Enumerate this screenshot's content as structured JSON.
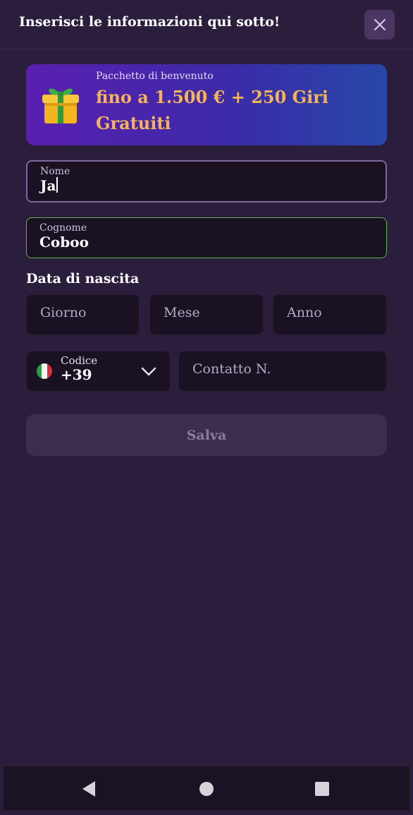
{
  "header": {
    "title": "Inserisci le informazioni qui sotto!"
  },
  "banner": {
    "subtitle": "Pacchetto di benvenuto",
    "offer": "fino a 1.500 € + 250 Giri Gratuiti"
  },
  "form": {
    "first_name": {
      "label": "Nome",
      "value": "Ja"
    },
    "last_name": {
      "label": "Cognome",
      "value": "Coboo"
    },
    "birth_date": {
      "label": "Data di nascita",
      "day_placeholder": "Giorno",
      "month_placeholder": "Mese",
      "year_placeholder": "Anno"
    },
    "phone": {
      "code_label": "Codice",
      "code_value": "+39",
      "number_placeholder": "Contatto N."
    },
    "save_label": "Salva"
  },
  "colors": {
    "background": "#2b1d3c",
    "input_background": "#1a1122",
    "offer_accent": "#f5b45a",
    "valid_border": "#5fb44a",
    "focus_border": "#7b6a9b"
  },
  "icons": [
    "close-icon",
    "gift-icon",
    "italy-flag-icon",
    "chevron-down-icon",
    "nav-back-icon",
    "nav-home-icon",
    "nav-recents-icon"
  ]
}
